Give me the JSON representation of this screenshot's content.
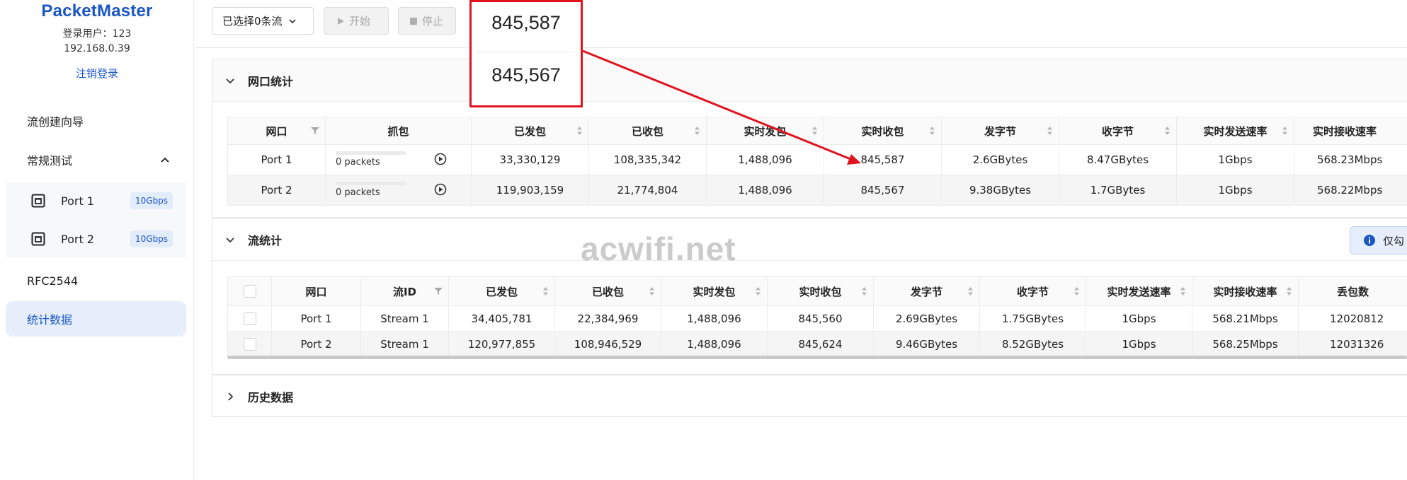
{
  "sidebar": {
    "brand": "PacketMaster",
    "user_line": "登录用户：123",
    "ip": "192.168.0.39",
    "logout": "注销登录",
    "items": {
      "flow_wizard": "流创建向导",
      "regular_test": "常规测试",
      "port1": {
        "label": "Port 1",
        "badge": "10Gbps"
      },
      "port2": {
        "label": "Port 2",
        "badge": "10Gbps"
      },
      "rfc2544": "RFC2544",
      "stats": "统计数据"
    }
  },
  "toolbar": {
    "select_label": "已选择0条流",
    "start_label": "开始",
    "stop_label": "停止"
  },
  "callout": {
    "value1": "845,587",
    "value2": "845,567"
  },
  "port_stats": {
    "title": "网口统计",
    "headers": [
      "网口",
      "抓包",
      "已发包",
      "已收包",
      "实时发包",
      "实时收包",
      "发字节",
      "收字节",
      "实时发送速率",
      "实时接收速率"
    ],
    "rows": [
      {
        "port": "Port 1",
        "capture": "0 packets",
        "sent": "33,330,129",
        "recv": "108,335,342",
        "rt_sent": "1,488,096",
        "rt_recv": "845,587",
        "bytes_sent": "2.6GBytes",
        "bytes_recv": "8.47GBytes",
        "tx_rate": "1Gbps",
        "rx_rate": "568.23Mbps"
      },
      {
        "port": "Port 2",
        "capture": "0 packets",
        "sent": "119,903,159",
        "recv": "21,774,804",
        "rt_sent": "1,488,096",
        "rt_recv": "845,567",
        "bytes_sent": "9.38GBytes",
        "bytes_recv": "1.7GBytes",
        "tx_rate": "1Gbps",
        "rx_rate": "568.22Mbps"
      }
    ]
  },
  "flow_stats": {
    "title": "流统计",
    "info_label": "仅勾",
    "headers": [
      "网口",
      "流ID",
      "已发包",
      "已收包",
      "实时发包",
      "实时收包",
      "发字节",
      "收字节",
      "实时发送速率",
      "实时接收速率",
      "丢包数"
    ],
    "rows": [
      {
        "port": "Port 1",
        "stream": "Stream 1",
        "sent": "34,405,781",
        "recv": "22,384,969",
        "rt_sent": "1,488,096",
        "rt_recv": "845,560",
        "bytes_sent": "2.69GBytes",
        "bytes_recv": "1.75GBytes",
        "tx_rate": "1Gbps",
        "rx_rate": "568.21Mbps",
        "lost": "12020812"
      },
      {
        "port": "Port 2",
        "stream": "Stream 1",
        "sent": "120,977,855",
        "recv": "108,946,529",
        "rt_sent": "1,488,096",
        "rt_recv": "845,624",
        "bytes_sent": "9.46GBytes",
        "bytes_recv": "8.52GBytes",
        "tx_rate": "1Gbps",
        "rx_rate": "568.25Mbps",
        "lost": "12031326"
      }
    ]
  },
  "history": {
    "title": "历史数据"
  },
  "watermark": "acwifi.net",
  "colors": {
    "accent": "#1a56c4",
    "annotation": "#e0141e"
  }
}
